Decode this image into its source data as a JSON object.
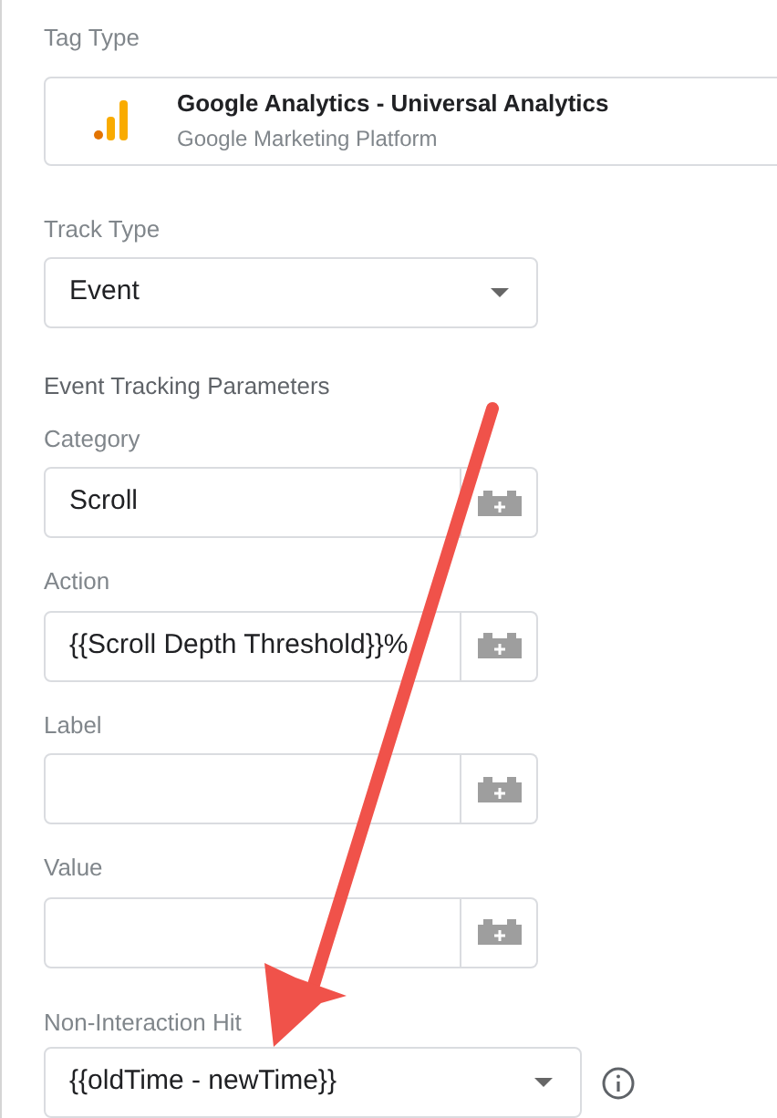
{
  "tag_type": {
    "label": "Tag Type",
    "name": "Google Analytics - Universal Analytics",
    "vendor": "Google Marketing Platform"
  },
  "track_type": {
    "label": "Track Type",
    "value": "Event"
  },
  "event_tracking": {
    "heading": "Event Tracking Parameters",
    "fields": [
      {
        "label": "Category",
        "value": "Scroll"
      },
      {
        "label": "Action",
        "value": "{{Scroll Depth Threshold}}%"
      },
      {
        "label": "Label"
      },
      {
        "label": "Value"
      }
    ]
  },
  "non_interaction": {
    "label": "Non-Interaction Hit",
    "value": "{{oldTime - newTime}}"
  }
}
